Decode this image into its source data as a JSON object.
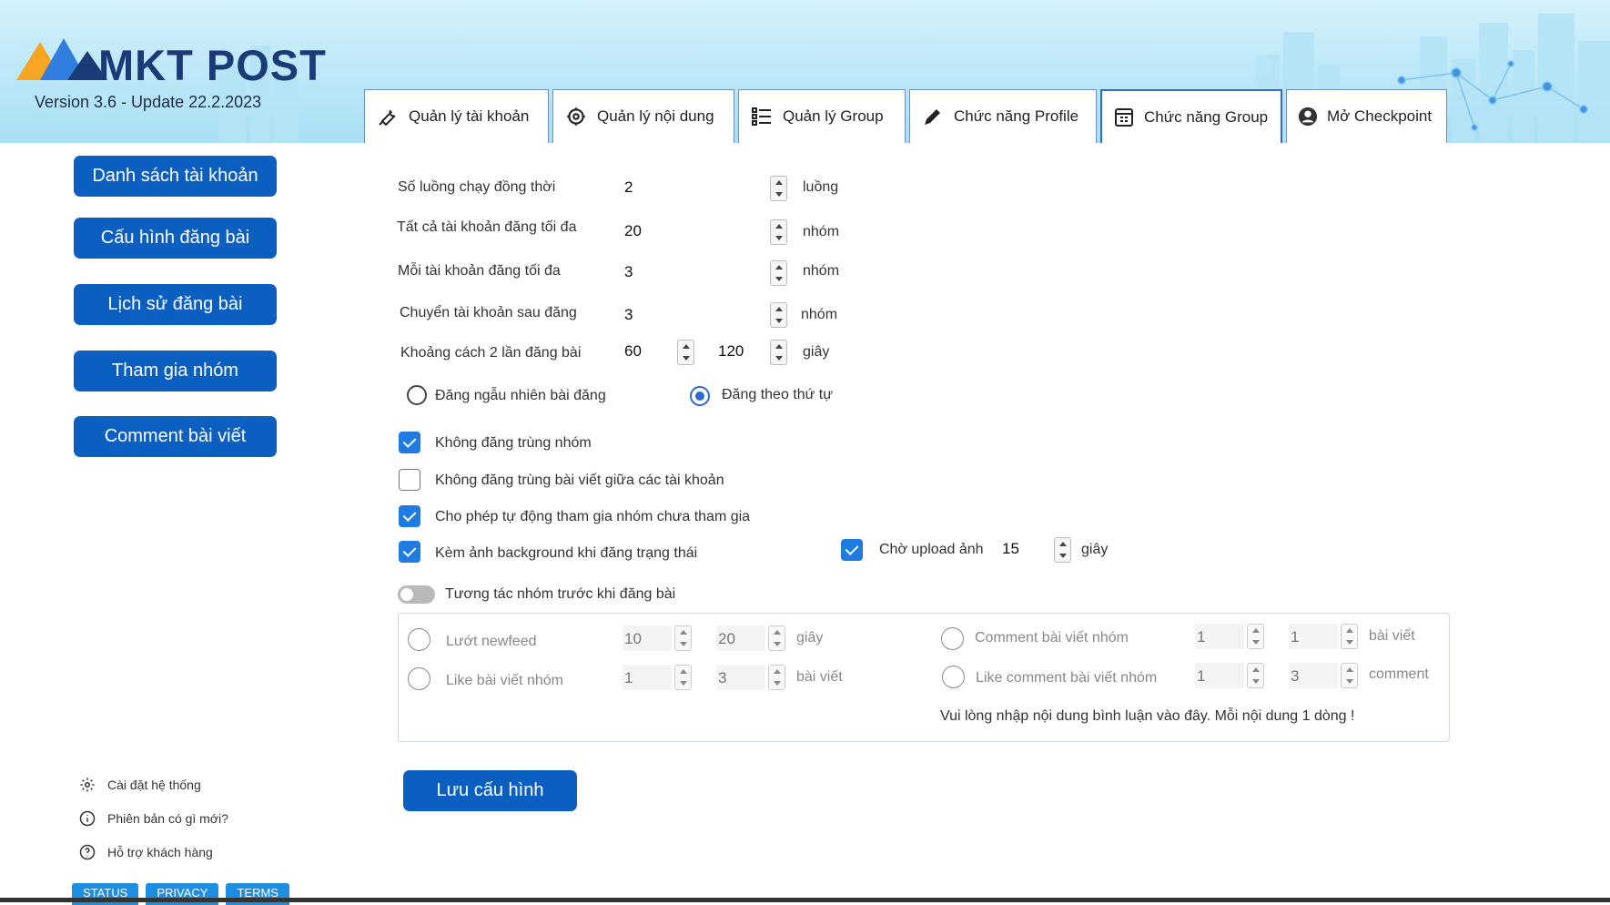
{
  "app": {
    "brand": "MKT POST",
    "version": "Version 3.6 - Update 22.2.2023"
  },
  "tabs": [
    {
      "label": "Quản lý tài khoản",
      "icon": "wrench-icon"
    },
    {
      "label": "Quản lý nội dung",
      "icon": "content-settings-icon"
    },
    {
      "label": "Quản lý Group",
      "icon": "list-icon"
    },
    {
      "label": "Chức năng Profile",
      "icon": "pencil-icon"
    },
    {
      "label": "Chức năng Group",
      "icon": "calendar-grid-icon",
      "active": true
    },
    {
      "label": "Mở Checkpoint",
      "icon": "user-circle-icon"
    }
  ],
  "sidebar": {
    "buttons": [
      "Danh sách tài khoản",
      "Cấu hình đăng bài",
      "Lịch sử đăng bài",
      "Tham gia nhóm",
      "Comment bài viết"
    ],
    "links": [
      {
        "label": "Cài đặt hệ thống",
        "icon": "gear-icon"
      },
      {
        "label": "Phiên bản có gì mới?",
        "icon": "info-icon"
      },
      {
        "label": "Hỗ trợ khách hàng",
        "icon": "help-icon"
      }
    ],
    "badges": [
      "STATUS",
      "PRIVACY",
      "TERMS"
    ]
  },
  "form": {
    "threads": {
      "label": "Số luồng chạy đồng thời",
      "value": "2",
      "unit": "luồng"
    },
    "all_max": {
      "label": "Tất cả tài khoản đăng tối đa",
      "value": "20",
      "unit": "nhóm"
    },
    "each_max": {
      "label": "Mỗi tài khoản đăng tối đa",
      "value": "3",
      "unit": "nhóm"
    },
    "switch_after": {
      "label": "Chuyển tài khoản sau đăng",
      "value": "3",
      "unit": "nhóm"
    },
    "interval": {
      "label": "Khoảng cách 2 lần đăng bài",
      "min": "60",
      "max": "120",
      "unit": "giây"
    },
    "order": {
      "random_label": "Đăng ngẫu nhiên bài đăng",
      "sequential_label": "Đăng theo thứ tự",
      "selected": "sequential"
    },
    "options": [
      {
        "label": "Không đăng trùng nhóm",
        "checked": true
      },
      {
        "label": "Không đăng trùng bài viết giữa các tài khoản",
        "checked": false
      },
      {
        "label": "Cho phép tự động tham gia nhóm chưa tham gia",
        "checked": true
      },
      {
        "label": "Kèm ảnh background khi đăng trạng thái",
        "checked": true
      }
    ],
    "upload_wait": {
      "label": "Chờ upload ảnh",
      "checked": true,
      "value": "15",
      "unit": "giây"
    },
    "interact": {
      "label": "Tương tác nhóm trước khi đăng bài",
      "enabled": false
    },
    "interact_panel": {
      "scroll_feed": {
        "label": "Lướt newfeed",
        "min": "10",
        "max": "20",
        "unit": "giây"
      },
      "like_posts": {
        "label": "Like bài viết nhóm",
        "min": "1",
        "max": "3",
        "unit": "bài viết"
      },
      "comment_posts": {
        "label": "Comment bài viết nhóm",
        "min": "1",
        "max": "1",
        "unit": "bài viết"
      },
      "like_comments": {
        "label": "Like comment bài viết nhóm",
        "min": "1",
        "max": "3",
        "unit": "comment"
      },
      "hint": "Vui lòng nhập nội dung bình luận vào đây. Mỗi nội dung 1 dòng !"
    },
    "save_label": "Lưu cấu hình"
  }
}
